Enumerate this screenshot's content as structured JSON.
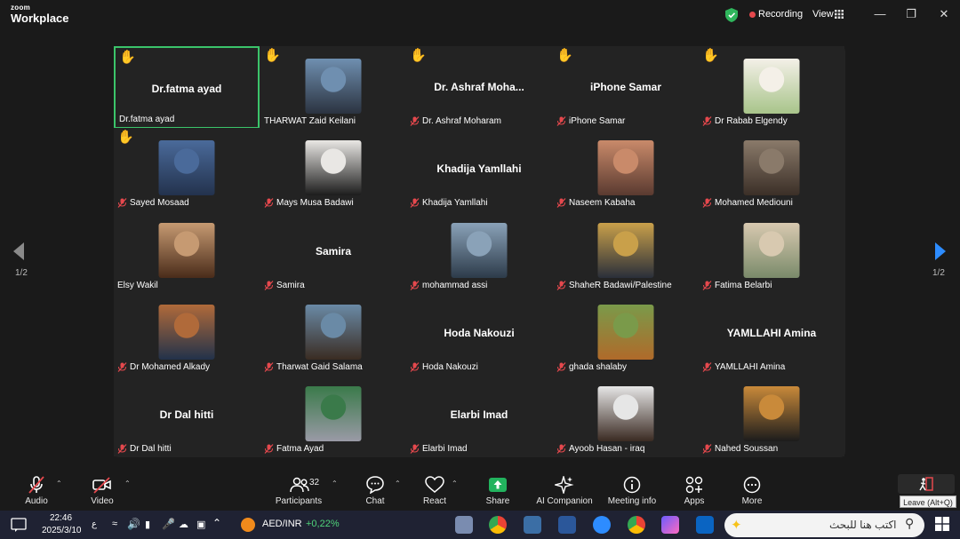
{
  "titlebar": {
    "brand_small": "zoom",
    "brand_large": "Workplace",
    "recording_label": "Recording",
    "view_label": "View"
  },
  "gallery": {
    "page_left": "1/2",
    "page_right": "1/2",
    "tiles": [
      {
        "label": "Dr.fatma ayad",
        "name_center": "Dr.fatma ayad",
        "hand": true,
        "muted": false,
        "active": true
      },
      {
        "label": "THARWAT Zaid Keilani",
        "name_center": "",
        "hand": true,
        "muted": false,
        "photo_colors": [
          "#6f8fb0",
          "#2b3340"
        ]
      },
      {
        "label": "Dr. Ashraf Moharam",
        "name_center": "Dr. Ashraf Moha...",
        "hand": true,
        "muted": true
      },
      {
        "label": "iPhone Samar",
        "name_center": "iPhone Samar",
        "hand": true,
        "muted": true
      },
      {
        "label": "Dr Rabab Elgendy",
        "name_center": "",
        "hand": true,
        "muted": true,
        "photo_colors": [
          "#f4f0e8",
          "#a8c48a"
        ]
      },
      {
        "label": "Sayed Mosaad",
        "name_center": "",
        "hand": true,
        "muted": true,
        "photo_colors": [
          "#4a6a9a",
          "#23324d"
        ]
      },
      {
        "label": "Mays Musa Badawi",
        "name_center": "",
        "hand": false,
        "muted": true,
        "photo_colors": [
          "#e9e7e4",
          "#1c1c1c"
        ]
      },
      {
        "label": "Khadija Yamllahi",
        "name_center": "Khadija Yamllahi",
        "hand": false,
        "muted": true
      },
      {
        "label": "Naseem Kabaha",
        "name_center": "",
        "hand": false,
        "muted": true,
        "photo_colors": [
          "#c98a6a",
          "#5a3a30"
        ]
      },
      {
        "label": "Mohamed Mediouni",
        "name_center": "",
        "hand": false,
        "muted": true,
        "photo_colors": [
          "#8a7a6a",
          "#3b2f27"
        ]
      },
      {
        "label": "Elsy Wakil",
        "name_center": "",
        "hand": false,
        "muted": false,
        "photo_colors": [
          "#c69a72",
          "#4a2c1a"
        ]
      },
      {
        "label": "Samira",
        "name_center": "Samira",
        "hand": false,
        "muted": true
      },
      {
        "label": "mohammad assi",
        "name_center": "",
        "hand": false,
        "muted": true,
        "photo_colors": [
          "#8aa2b8",
          "#2d3b4a"
        ]
      },
      {
        "label": "ShaheR Badawi/Palestine",
        "name_center": "",
        "hand": false,
        "muted": true,
        "photo_colors": [
          "#c9a04a",
          "#2a2f3a"
        ]
      },
      {
        "label": "Fatima Belarbi",
        "name_center": "",
        "hand": false,
        "muted": true,
        "photo_colors": [
          "#d8c9b0",
          "#7a8a6a"
        ]
      },
      {
        "label": "Dr Mohamed Alkady",
        "name_center": "",
        "hand": false,
        "muted": true,
        "photo_colors": [
          "#b06a3a",
          "#22324a"
        ]
      },
      {
        "label": "Tharwat Gaid Salama",
        "name_center": "",
        "hand": false,
        "muted": true,
        "photo_colors": [
          "#6a8aa6",
          "#3a2c22"
        ]
      },
      {
        "label": "Hoda Nakouzi",
        "name_center": "Hoda Nakouzi",
        "hand": false,
        "muted": true
      },
      {
        "label": "ghada shalaby",
        "name_center": "",
        "hand": false,
        "muted": true,
        "photo_colors": [
          "#7a9a4a",
          "#b06a2a"
        ]
      },
      {
        "label": "YAMLLAHI Amina",
        "name_center": "YAMLLAHI Amina",
        "hand": false,
        "muted": true
      },
      {
        "label": "Dr Dal hitti",
        "name_center": "Dr Dal hitti",
        "hand": false,
        "muted": true
      },
      {
        "label": "Fatma Ayad",
        "name_center": "",
        "hand": false,
        "muted": true,
        "photo_colors": [
          "#3a7a4a",
          "#9a9aa6"
        ]
      },
      {
        "label": "Elarbi Imad",
        "name_center": "Elarbi Imad",
        "hand": false,
        "muted": true
      },
      {
        "label": "Ayoob Hasan - iraq",
        "name_center": "",
        "hand": false,
        "muted": true,
        "photo_colors": [
          "#e6e6e6",
          "#3a2a22"
        ]
      },
      {
        "label": "Nahed Soussan",
        "name_center": "",
        "hand": false,
        "muted": true,
        "photo_colors": [
          "#c98a3a",
          "#1c1c1c"
        ]
      }
    ]
  },
  "toolbar": {
    "audio": "Audio",
    "video": "Video",
    "participants": "Participants",
    "participants_count": "32",
    "chat": "Chat",
    "react": "React",
    "share": "Share",
    "ai_companion": "AI Companion",
    "meeting_info": "Meeting info",
    "apps": "Apps",
    "more": "More",
    "leave_tooltip": "Leave (Alt+Q)"
  },
  "taskbar": {
    "time": "22:46",
    "date": "2025/3/10",
    "lang": "ع",
    "ticker_symbol": "AED/INR",
    "ticker_change": "+0,22%",
    "search_placeholder": "اكتب هنا للبحث"
  },
  "colors": {
    "accent_green": "#3bc46a",
    "muted_red": "#e5484d",
    "share_green": "#22b35e",
    "hand_yellow": "#f6c21b"
  }
}
